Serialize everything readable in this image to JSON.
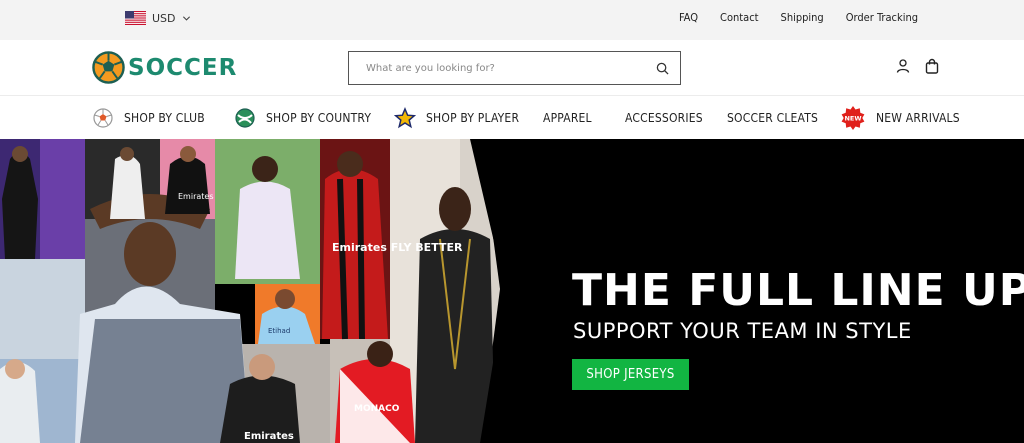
{
  "topbar": {
    "currency": {
      "label": "USD",
      "flag_icon": "us-flag-icon"
    },
    "links": [
      "FAQ",
      "Contact",
      "Shipping",
      "Order Tracking"
    ]
  },
  "header": {
    "logo_text": "SOCCER",
    "search": {
      "placeholder": "What are you looking for?",
      "value": ""
    },
    "icons": [
      "user-icon",
      "shopping-bag-icon"
    ]
  },
  "nav": {
    "items": [
      {
        "label": "SHOP BY CLUB",
        "icon": "soccer-ball-icon"
      },
      {
        "label": "SHOP BY COUNTRY",
        "icon": "globe-ball-icon"
      },
      {
        "label": "SHOP BY PLAYER",
        "icon": "star-icon"
      },
      {
        "label": "APPAREL"
      },
      {
        "label": "ACCESSORIES"
      },
      {
        "label": "SOCCER CLEATS"
      },
      {
        "label": "NEW ARRIVALS",
        "icon": "new-badge-icon",
        "badge": "NEW"
      }
    ]
  },
  "hero": {
    "title": "THE FULL LINE UP",
    "subtitle": "SUPPORT YOUR TEAM IN STYLE",
    "cta": "SHOP JERSEYS",
    "collage_jersey_texts": [
      "Emirates FLY BETTER",
      "Emirates",
      "MONACO",
      "Etihad",
      "Emirates"
    ],
    "colors": {
      "cta": "#12b542",
      "background": "#000000",
      "brand": "#1d8a6f"
    }
  }
}
